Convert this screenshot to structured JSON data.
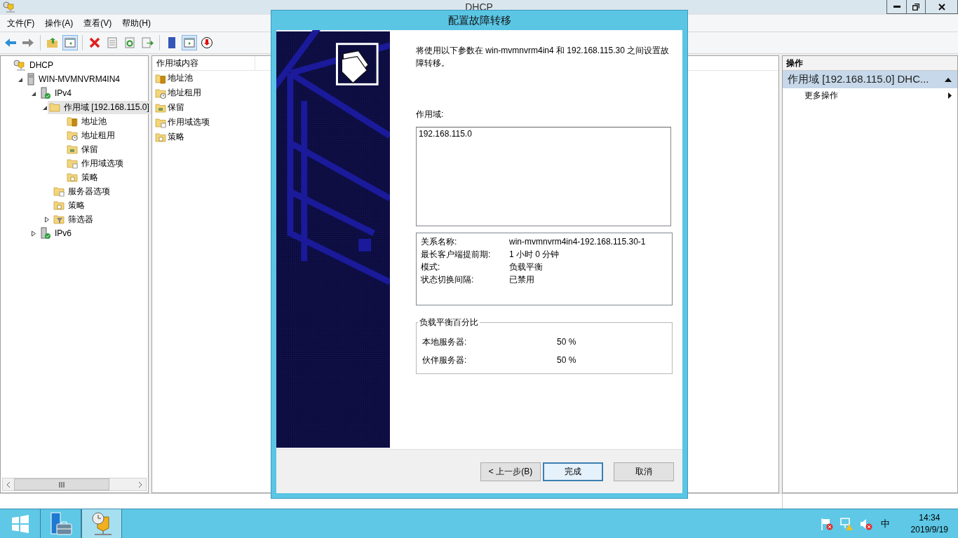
{
  "window": {
    "title": "DHCP",
    "menu": [
      "文件(F)",
      "操作(A)",
      "查看(V)",
      "帮助(H)"
    ]
  },
  "toolbar": [
    {
      "kind": "back",
      "pressed": false
    },
    {
      "kind": "forward",
      "pressed": false
    },
    {
      "kind": "separator"
    },
    {
      "kind": "up",
      "pressed": false
    },
    {
      "kind": "tree",
      "pressed": true
    },
    {
      "kind": "separator"
    },
    {
      "kind": "delete",
      "pressed": false
    },
    {
      "kind": "properties",
      "pressed": false
    },
    {
      "kind": "refresh",
      "pressed": false
    },
    {
      "kind": "export",
      "pressed": false
    },
    {
      "kind": "separator"
    },
    {
      "kind": "help",
      "pressed": false
    },
    {
      "kind": "actionpane",
      "pressed": true
    },
    {
      "kind": "stop",
      "pressed": false
    }
  ],
  "tree": [
    {
      "label": "DHCP",
      "kind": "dhcp",
      "selected": false,
      "children": [
        {
          "label": "WIN-MVMNVRM4IN4",
          "kind": "server",
          "expanded": true,
          "selected": false,
          "children": [
            {
              "label": "IPv4",
              "kind": "ip",
              "expanded": true,
              "selected": false,
              "children": [
                {
                  "label": "作用域 [192.168.115.0]",
                  "kind": "folder",
                  "expanded": true,
                  "selected": true,
                  "children": [
                    {
                      "label": "地址池",
                      "kind": "pool",
                      "selected": false
                    },
                    {
                      "label": "地址租用",
                      "kind": "lease",
                      "selected": false
                    },
                    {
                      "label": "保留",
                      "kind": "reservation",
                      "selected": false
                    },
                    {
                      "label": "作用域选项",
                      "kind": "options",
                      "selected": false
                    },
                    {
                      "label": "策略",
                      "kind": "policy",
                      "selected": false
                    }
                  ]
                },
                {
                  "label": "服务器选项",
                  "kind": "options",
                  "selected": false
                },
                {
                  "label": "策略",
                  "kind": "policy",
                  "selected": false
                },
                {
                  "label": "筛选器",
                  "kind": "filter",
                  "expanded": false,
                  "selected": false
                }
              ]
            },
            {
              "label": "IPv6",
              "kind": "ip",
              "expanded": false,
              "selected": false
            }
          ]
        }
      ]
    }
  ],
  "content_pane": {
    "column": "作用域内容",
    "items": [
      {
        "label": "地址池",
        "kind": "pool"
      },
      {
        "label": "地址租用",
        "kind": "lease"
      },
      {
        "label": "保留",
        "kind": "reservation"
      },
      {
        "label": "作用域选项",
        "kind": "options"
      },
      {
        "label": "策略",
        "kind": "policy"
      }
    ]
  },
  "actions_pane": {
    "title": "操作",
    "group": {
      "label": "作用域 [192.168.115.0] DHC...",
      "expanded": true
    },
    "items": [
      "更多操作"
    ]
  },
  "dialog": {
    "title": "配置故障转移",
    "intro": "将使用以下参数在 win-mvmnvrm4in4 和 192.168.115.30 之间设置故障转移。",
    "scope_label": "作用域:",
    "scopes": [
      "192.168.115.0"
    ],
    "details": [
      {
        "label": "关系名称:",
        "value": "win-mvmnvrm4in4-192.168.115.30-1"
      },
      {
        "label": "最长客户端提前期:",
        "value": "1 小时 0 分钟"
      },
      {
        "label": "模式:",
        "value": "负载平衡"
      },
      {
        "label": "状态切换间隔:",
        "value": "已禁用"
      }
    ],
    "balance": {
      "legend": "负载平衡百分比",
      "rows": [
        {
          "label": "本地服务器:",
          "value": "50 %"
        },
        {
          "label": "伙伴服务器:",
          "value": "50 %"
        }
      ]
    },
    "buttons": [
      {
        "label": "< 上一步(B)",
        "default": false
      },
      {
        "label": "完成",
        "default": true
      },
      {
        "label": "取消",
        "default": false
      }
    ]
  },
  "taskbar": {
    "apps": [
      {
        "kind": "start",
        "selected": false
      },
      {
        "kind": "servermanager",
        "selected": false
      },
      {
        "kind": "dhcp",
        "selected": true
      }
    ],
    "tray": [
      {
        "kind": "flag"
      },
      {
        "kind": "network"
      },
      {
        "kind": "speaker"
      }
    ],
    "ime": "中",
    "time": "14:34",
    "date": "2019/9/19"
  }
}
